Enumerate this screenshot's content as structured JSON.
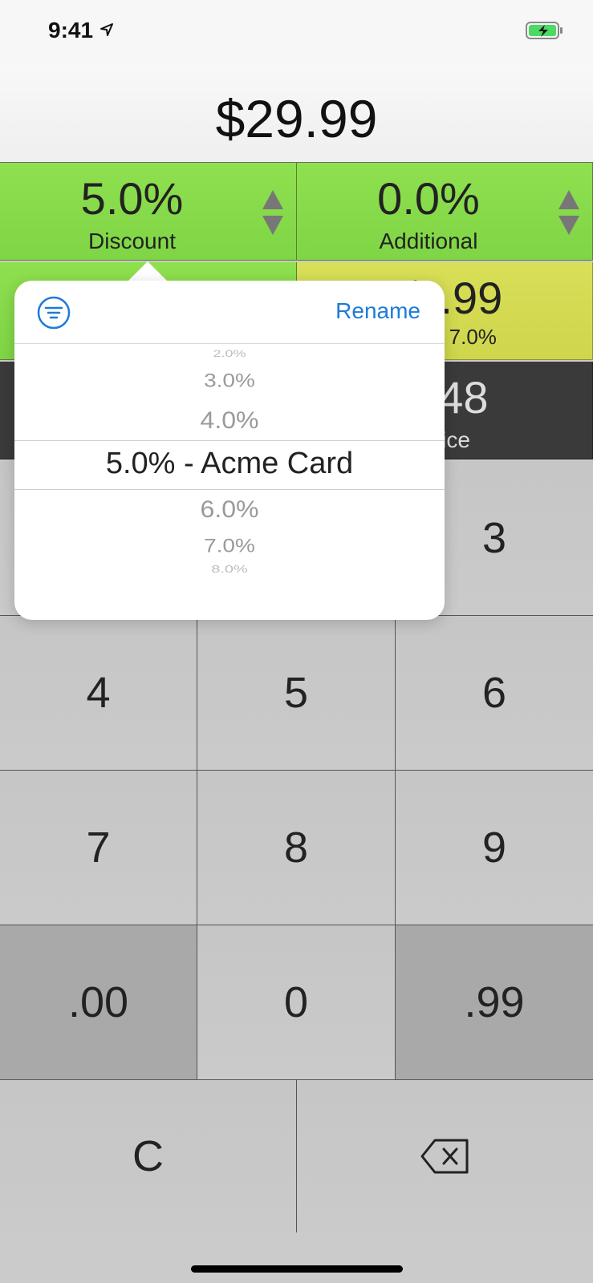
{
  "status_bar": {
    "time": "9:41"
  },
  "header": {
    "price": "$29.99"
  },
  "tiles": {
    "discount": {
      "value": "5.0%",
      "label": "Discount"
    },
    "additional": {
      "value": "0.0%",
      "label": "Additional"
    },
    "savings": {
      "value": "$"
    },
    "tax": {
      "value": "$ .99",
      "label": "us - 7.0%"
    },
    "total": {
      "value": "0.48",
      "label": "Price"
    }
  },
  "popover": {
    "rename_label": "Rename",
    "picker_items": [
      "2.0%",
      "3.0%",
      "4.0%",
      "5.0% - Acme Card",
      "6.0%",
      "7.0%",
      "8.0%"
    ],
    "selected_index": 3
  },
  "keypad": {
    "row1": [
      "",
      "",
      "3"
    ],
    "row2": [
      "4",
      "5",
      "6"
    ],
    "row3": [
      "7",
      "8",
      "9"
    ],
    "row4": [
      ".00",
      "0",
      ".99"
    ],
    "clear": "C"
  },
  "colors": {
    "green": "#8fe04f",
    "yellow": "#d8df58",
    "dark": "#3a3a3a",
    "accent": "#1e7ad8"
  }
}
